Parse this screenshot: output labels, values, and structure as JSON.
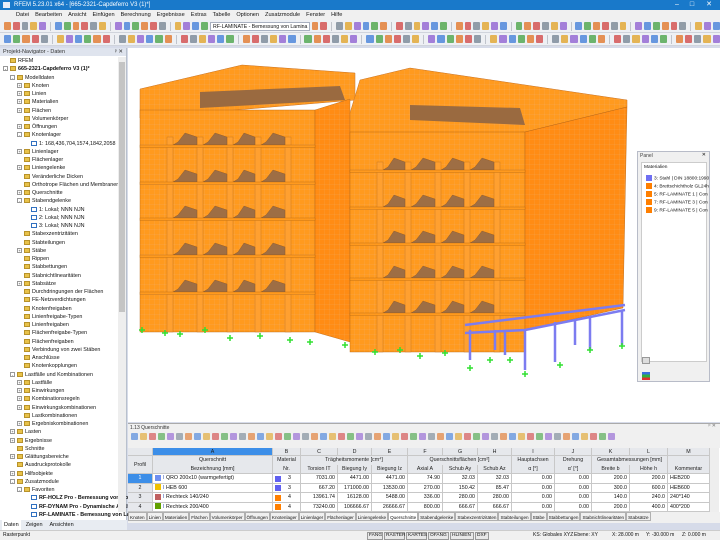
{
  "app": {
    "title": "RFEM 5.23.01 x64 - [665-2321-Capdeferro V3 (1)*]"
  },
  "menu": [
    "Datei",
    "Bearbeiten",
    "Ansicht",
    "Einfügen",
    "Berechnung",
    "Ergebnisse",
    "Extras",
    "Tabelle",
    "Optionen",
    "Zusatzmodule",
    "Fenster",
    "Hilfe"
  ],
  "toolbar": {
    "module_combo": "RF-LAMINATE - Bemessung von Lamina"
  },
  "navigator": {
    "title": "Projekt-Navigator - Daten",
    "tree": [
      {
        "l": 0,
        "t": "RFEM",
        "e": ""
      },
      {
        "l": 0,
        "t": "665-2321-Capdeferro V3 (1)*",
        "e": "-",
        "b": true
      },
      {
        "l": 1,
        "t": "Modelldaten",
        "e": "-"
      },
      {
        "l": 2,
        "t": "Knoten",
        "e": "+"
      },
      {
        "l": 2,
        "t": "Linien",
        "e": "+"
      },
      {
        "l": 2,
        "t": "Materialien",
        "e": "+"
      },
      {
        "l": 2,
        "t": "Flächen",
        "e": "+"
      },
      {
        "l": 2,
        "t": "Volumenkörper",
        "e": ""
      },
      {
        "l": 2,
        "t": "Öffnungen",
        "e": "+"
      },
      {
        "l": 2,
        "t": "Knotenlager",
        "e": "-"
      },
      {
        "l": 3,
        "t": "1: 168,436,704,1574,1842,2058",
        "e": ""
      },
      {
        "l": 2,
        "t": "Linienlager",
        "e": "+"
      },
      {
        "l": 2,
        "t": "Flächenlager",
        "e": ""
      },
      {
        "l": 2,
        "t": "Liniengelenke",
        "e": "+"
      },
      {
        "l": 2,
        "t": "Veränderliche Dicken",
        "e": ""
      },
      {
        "l": 2,
        "t": "Orthotrope Flächen und Membranen",
        "e": ""
      },
      {
        "l": 2,
        "t": "Querschnitte",
        "e": "+"
      },
      {
        "l": 2,
        "t": "Stabendgelenke",
        "e": "-"
      },
      {
        "l": 3,
        "t": "1: Lokal; NNN NJN",
        "e": ""
      },
      {
        "l": 3,
        "t": "2: Lokal; NNN NJN",
        "e": ""
      },
      {
        "l": 3,
        "t": "3: Lokal; NNN NJN",
        "e": ""
      },
      {
        "l": 2,
        "t": "Stabexzentrizitäten",
        "e": ""
      },
      {
        "l": 2,
        "t": "Stabteilungen",
        "e": ""
      },
      {
        "l": 2,
        "t": "Stäbe",
        "e": "+"
      },
      {
        "l": 2,
        "t": "Rippen",
        "e": ""
      },
      {
        "l": 2,
        "t": "Stabbettungen",
        "e": ""
      },
      {
        "l": 2,
        "t": "Stabnichtlinearitäten",
        "e": ""
      },
      {
        "l": 2,
        "t": "Stabsätze",
        "e": "+"
      },
      {
        "l": 2,
        "t": "Durchdringungen der Flächen",
        "e": ""
      },
      {
        "l": 2,
        "t": "FE-Netzverdichtungen",
        "e": ""
      },
      {
        "l": 2,
        "t": "Knotenfreigaben",
        "e": ""
      },
      {
        "l": 2,
        "t": "Linienfreigabe-Typen",
        "e": ""
      },
      {
        "l": 2,
        "t": "Linienfreigaben",
        "e": ""
      },
      {
        "l": 2,
        "t": "Flächenfreigabe-Typen",
        "e": ""
      },
      {
        "l": 2,
        "t": "Flächenfreigaben",
        "e": ""
      },
      {
        "l": 2,
        "t": "Verbindung von zwei Stäben",
        "e": ""
      },
      {
        "l": 2,
        "t": "Anschlüsse",
        "e": ""
      },
      {
        "l": 2,
        "t": "Knotenkopplungen",
        "e": ""
      },
      {
        "l": 1,
        "t": "Lastfälle und Kombinationen",
        "e": "-"
      },
      {
        "l": 2,
        "t": "Lastfälle",
        "e": "+"
      },
      {
        "l": 2,
        "t": "Einwirkungen",
        "e": "+"
      },
      {
        "l": 2,
        "t": "Kombinationsregeln",
        "e": "+"
      },
      {
        "l": 2,
        "t": "Einwirkungskombinationen",
        "e": "+"
      },
      {
        "l": 2,
        "t": "Lastkombinationen",
        "e": ""
      },
      {
        "l": 2,
        "t": "Ergebniskombinationen",
        "e": "+"
      },
      {
        "l": 1,
        "t": "Lasten",
        "e": "+"
      },
      {
        "l": 1,
        "t": "Ergebnisse",
        "e": "+"
      },
      {
        "l": 1,
        "t": "Schnitte",
        "e": ""
      },
      {
        "l": 1,
        "t": "Glättungsbereiche",
        "e": "+"
      },
      {
        "l": 1,
        "t": "Ausdruckprotokolle",
        "e": ""
      },
      {
        "l": 1,
        "t": "Hilfsobjekte",
        "e": "+"
      },
      {
        "l": 1,
        "t": "Zusatzmodule",
        "e": "-"
      },
      {
        "l": 2,
        "t": "Favoriten",
        "e": "-"
      },
      {
        "l": 3,
        "t": "RF-HOLZ Pro - Bemessung von Holzstäben",
        "e": "",
        "b": true
      },
      {
        "l": 3,
        "t": "RF-DYNAM Pro - Dynamische Analyse",
        "e": "",
        "b": true
      },
      {
        "l": 3,
        "t": "RF-LAMINATE - Bemessung von Laminatflächen",
        "e": "",
        "b": true
      }
    ],
    "tabs": [
      "Daten",
      "Zeigen",
      "Ansichten"
    ]
  },
  "panel": {
    "title": "Panel",
    "section": "Materialien",
    "items": [
      {
        "label": "3: Stahl | DIN 18800:1990",
        "color": "#6f6ff2"
      },
      {
        "label": "4: Brettschichtholz GL24h",
        "color": "#ff7f00"
      },
      {
        "label": "5: RF-LAMINATE 1 | Con",
        "color": "#ff7f00"
      },
      {
        "label": "7: RF-LAMINATE 3 | Con",
        "color": "#ff7f00"
      },
      {
        "label": "9: RF-LAMINATE 5 | Con",
        "color": "#ff7f00"
      }
    ]
  },
  "table": {
    "title": "1.13 Querschnitte",
    "letters": [
      "A",
      "B",
      "C",
      "D",
      "E",
      "F",
      "G",
      "H",
      "I",
      "J",
      "K",
      "L",
      "M"
    ],
    "groups": [
      "Querschnitt",
      "Material",
      "Trägheitsmomente [cm⁴]",
      "Querschnittsflächen [cm²]",
      "Hauptachsen",
      "Drehung",
      "Gesamtabmessungen [mm]"
    ],
    "headers": [
      "Profil Nr.",
      "Bezeichnung [mm]",
      "Nr.",
      "Torsion IT",
      "Biegung Iy",
      "Biegung Iz",
      "Axial A",
      "Schub Ay",
      "Schub Az",
      "α [°]",
      "α' [°]",
      "Breite b",
      "Höhe h",
      "Kommentar"
    ],
    "rows": [
      {
        "nr": "1",
        "color": "#6f8ff0",
        "name": "QRO 200x10 (warmgefertigt)",
        "mat": "3",
        "matcolor": "#6060f0",
        "v": [
          "7031.00",
          "4471.00",
          "4471.00",
          "74.90",
          "32.03",
          "32.03",
          "0.00",
          "0.00",
          "200.0",
          "200.0"
        ],
        "comment": "HEB200"
      },
      {
        "nr": "2",
        "color": "#f0c000",
        "name": "HEB 600",
        "mat": "3",
        "matcolor": "#6060f0",
        "v": [
          "667.20",
          "171000.00",
          "13530.00",
          "270.00",
          "150.42",
          "85.47",
          "0.00",
          "0.00",
          "300.0",
          "600.0"
        ],
        "comment": "HEB600"
      },
      {
        "nr": "3",
        "color": "#c06060",
        "name": "Rechteck 140/240",
        "mat": "4",
        "matcolor": "#ff7f00",
        "v": [
          "13961.74",
          "16128.00",
          "5488.00",
          "336.00",
          "280.00",
          "280.00",
          "0.00",
          "0.00",
          "140.0",
          "240.0"
        ],
        "comment": "240*140"
      },
      {
        "nr": "4",
        "color": "#60a000",
        "name": "Rechteck 200/400",
        "mat": "4",
        "matcolor": "#ff7f00",
        "v": [
          "73240.00",
          "106666.67",
          "26666.67",
          "800.00",
          "666.67",
          "666.67",
          "0.00",
          "0.00",
          "200.0",
          "400.0"
        ],
        "comment": "400*200"
      }
    ],
    "tabs": [
      "Knoten",
      "Linien",
      "Materialien",
      "Flächen",
      "Volumenkörper",
      "Öffnungen",
      "Knotenlager",
      "Linienlager",
      "Flächenlager",
      "Liniengelenke",
      "Querschnitte",
      "Stabendgelenke",
      "Stabexzentrizitäten",
      "Stabteilungen",
      "Stäbe",
      "Stabbettungen",
      "Stabnichtlinearitäten",
      "Stabsätze"
    ],
    "active_tab": "Querschnitte"
  },
  "status": {
    "left": "Rasterpunkt",
    "buttons": [
      "FANG",
      "RASTER",
      "KARTES",
      "OFANG",
      "HLINIEN",
      "DXF"
    ],
    "ks": "KS: Globales XYZ",
    "ebene": "Ebene: XY",
    "x": "X: 28.000 m",
    "y": "Y: -30.000 m",
    "z": "Z: 0.000 m"
  }
}
